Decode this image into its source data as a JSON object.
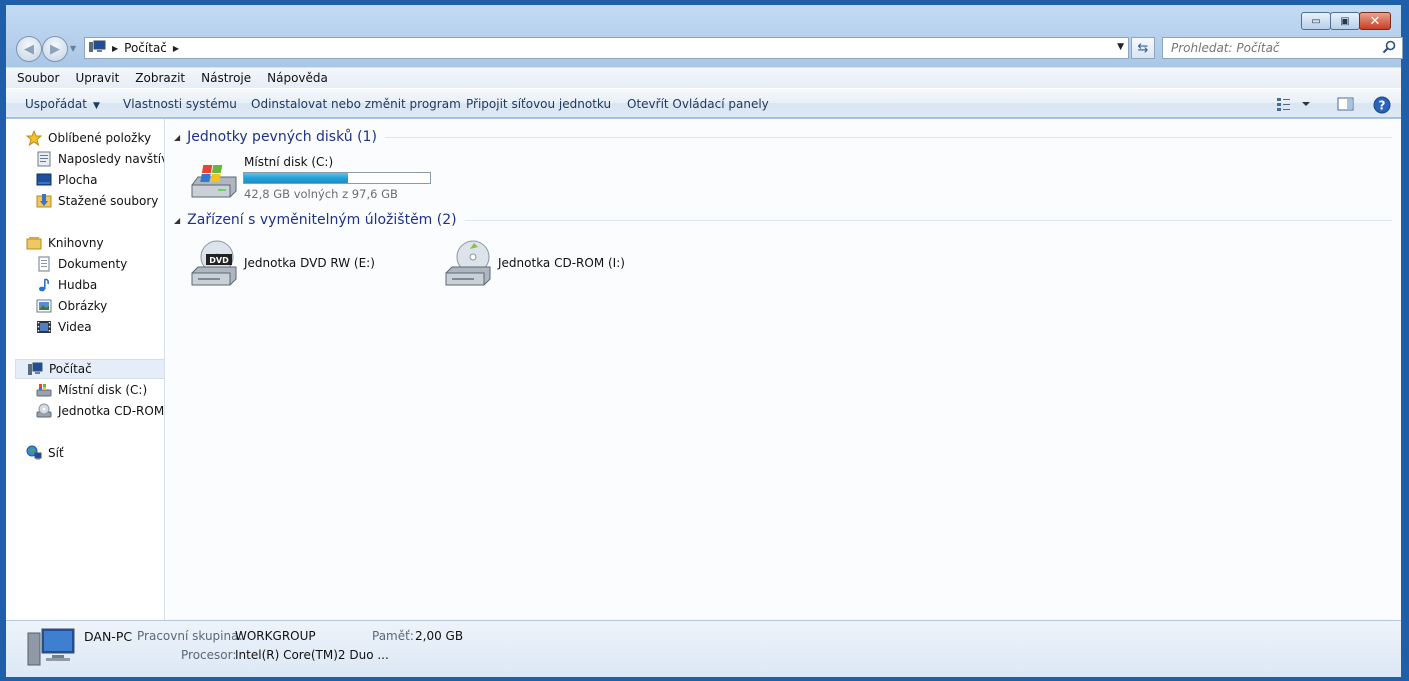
{
  "window": {
    "minimize_glyph": "▭",
    "maximize_glyph": "▣",
    "close_glyph": "✕"
  },
  "address": {
    "crumb": "Počítač",
    "search_placeholder": "Prohledat: Počítač"
  },
  "menubar": [
    "Soubor",
    "Upravit",
    "Zobrazit",
    "Nástroje",
    "Nápověda"
  ],
  "commands": {
    "organize": "Uspořádat",
    "system_properties": "Vlastnosti systému",
    "uninstall": "Odinstalovat nebo změnit program",
    "map_drive": "Připojit síťovou jednotku",
    "control_panel": "Otevřít Ovládací panely"
  },
  "nav": {
    "favorites": "Oblíbené položky",
    "recent": "Naposledy navštívené",
    "desktop": "Plocha",
    "downloads": "Stažené soubory",
    "libraries": "Knihovny",
    "documents": "Dokumenty",
    "music": "Hudba",
    "pictures": "Obrázky",
    "videos": "Videa",
    "computer": "Počítač",
    "local_disk": "Místní disk (C:)",
    "cdrom": "Jednotka CD-ROM (I:)",
    "network": "Síť"
  },
  "groups": {
    "hard_drives": "Jednotky pevných disků (1)",
    "removable": "Zařízení s vyměnitelným úložištěm (2)"
  },
  "drives": {
    "c_label": "Místní disk (C:)",
    "c_usage": "42,8 GB volných z 97,6 GB",
    "c_used_fraction": 0.56,
    "dvd_label": "Jednotka DVD RW (E:)",
    "dvd_badge": "DVD",
    "cd_label": "Jednotka CD-ROM (I:)"
  },
  "details": {
    "name": "DAN-PC",
    "workgroup_label": "Pracovní skupina:",
    "workgroup_value": "WORKGROUP",
    "memory_label": "Paměť:",
    "memory_value": "2,00 GB",
    "cpu_label": "Procesor:",
    "cpu_value": "Intel(R) Core(TM)2 Duo ..."
  }
}
